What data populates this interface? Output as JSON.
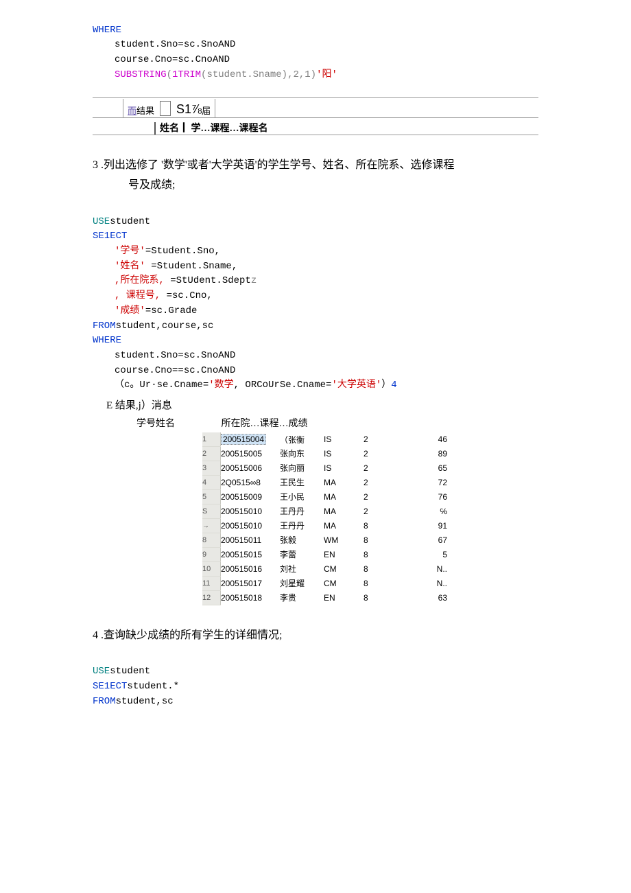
{
  "block1": {
    "l1": "WHERE",
    "l2": "student.Sno=sc.SnoAND",
    "l3": "course.Cno=sc.CnoAND",
    "l4a": "SUBSTRING",
    "l4b": "(",
    "l4c": "1TRIM",
    "l4d": "(student.Sname),2,1)",
    "l4e": "'阳'"
  },
  "rb1": {
    "linkword": "而",
    "res": "结果",
    "big": "S1⅞",
    "tail": "届",
    "row2": "姓名┃ 学…课程…课程名"
  },
  "q3": {
    "text": "3  .列出选修了 '数学'或者'大学英语'的学生学号、姓名、所在院系、选修课程",
    "text2": "号及成绩;"
  },
  "block2": {
    "l1a": "USE",
    "l1b": "student",
    "l2": "SE1ECT",
    "l3a": "'学号'",
    "l3b": "=Student.Sno,",
    "l4a": "'姓名'",
    "l4b": " =Student.Sname,",
    "l5a": ",所在院系,",
    "l5b": " =StUdent.Sdept",
    "l5c": "z",
    "l6a": ", 课程号,",
    "l6b": " =sc.Cno,",
    "l7a": "'成绩'",
    "l7b": "=sc.Grade",
    "l8a": "FROM",
    "l8b": "student,course,sc",
    "l9": "WHERE",
    "l10": "student.Sno=sc.SnoAND",
    "l11": "course.Cno==sc.CnoAND",
    "l12a": "（c。Ur·se.Cname=",
    "l12b": "'数学",
    "l12c": ", ORCoUrSe.Cname=",
    "l12d": "'大学英语'",
    "l12e": "）",
    "l12f": "4"
  },
  "msg": "E 结果,j）消息",
  "hdr": {
    "a": "学号姓名",
    "b": "所在院…课程…成绩"
  },
  "rows": [
    {
      "n": "1",
      "sno": "200515004",
      "name": "（张衡",
      "dept": "IS",
      "cno": "2",
      "grd": "46",
      "first": true
    },
    {
      "n": "2",
      "sno": "200515005",
      "name": "张向东",
      "dept": "IS",
      "cno": "2",
      "grd": "89"
    },
    {
      "n": "3",
      "sno": "200515006",
      "name": "张向丽",
      "dept": "IS",
      "cno": "2",
      "grd": "65"
    },
    {
      "n": "4",
      "sno": "2Q0515∞8",
      "name": "王民生",
      "dept": "MA",
      "cno": "2",
      "grd": "72"
    },
    {
      "n": "5",
      "sno": "200515009",
      "name": "王小民",
      "dept": "MA",
      "cno": "2",
      "grd": "76"
    },
    {
      "n": "S",
      "sno": "200515010",
      "name": "王丹丹",
      "dept": "MA",
      "cno": "2",
      "grd": "℅"
    },
    {
      "n": "",
      "sno": "200515010",
      "name": "王丹丹",
      "dept": "MA",
      "cno": "8",
      "grd": "91",
      "arrow": true
    },
    {
      "n": "8",
      "sno": "200515011",
      "name": "张毅",
      "dept": "WM",
      "cno": "8",
      "grd": "67"
    },
    {
      "n": "9",
      "sno": "200515015",
      "name": "李蕾",
      "dept": "EN",
      "cno": "8",
      "grd": "5"
    },
    {
      "n": "10",
      "sno": "200515016",
      "name": "刘社",
      "dept": "CM",
      "cno": "8",
      "grd": "N.."
    },
    {
      "n": "11",
      "sno": "200515017",
      "name": "刘星耀",
      "dept": "CM",
      "cno": "8",
      "grd": "N.."
    },
    {
      "n": "12",
      "sno": "200515018",
      "name": "李贵",
      "dept": "EN",
      "cno": "8",
      "grd": "63"
    }
  ],
  "q4": {
    "text": "4  .查询缺少成绩的所有学生的详细情况;"
  },
  "block3": {
    "l1a": "USE",
    "l1b": "student",
    "l2a": "SE1ECT",
    "l2b": "student.*",
    "l3a": "FROM",
    "l3b": "student,sc"
  }
}
